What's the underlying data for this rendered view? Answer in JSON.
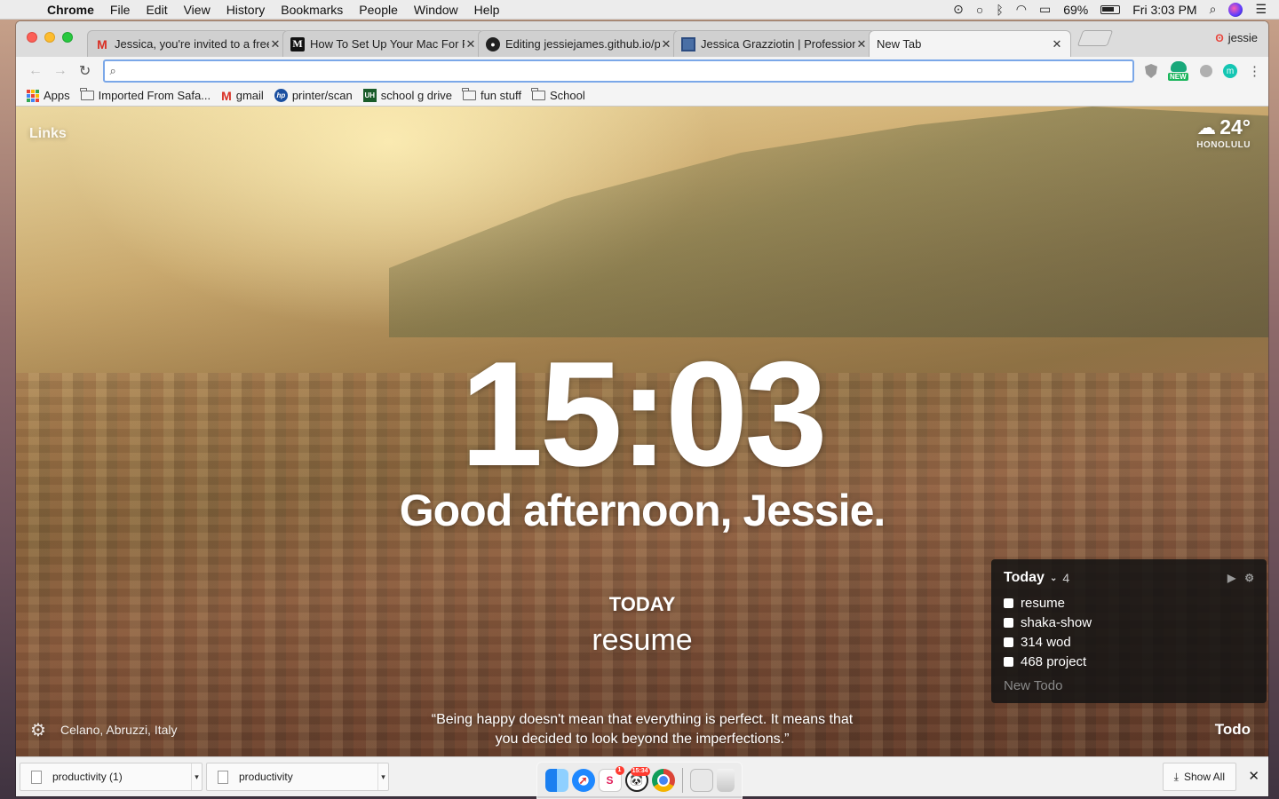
{
  "menubar": {
    "app_name": "Chrome",
    "items": [
      "File",
      "Edit",
      "View",
      "History",
      "Bookmarks",
      "People",
      "Window",
      "Help"
    ],
    "battery": "69%",
    "datetime": "Fri 3:03 PM"
  },
  "tabs": [
    {
      "title": "Jessica, you're invited to a free",
      "icon": "gmail-icon"
    },
    {
      "title": "How To Set Up Your Mac For F",
      "icon": "medium-icon"
    },
    {
      "title": "Editing jessiejames.github.io/p",
      "icon": "github-icon"
    },
    {
      "title": "Jessica Grazziotin | Profession",
      "icon": "doc-icon"
    },
    {
      "title": "New Tab",
      "icon": ""
    }
  ],
  "profile_name": "jessie",
  "omnibox": {
    "value": "",
    "placeholder": ""
  },
  "extensions": {
    "new_badge": "NEW",
    "m_label": "m"
  },
  "bookmarks": [
    {
      "label": "Apps",
      "icon": "apps-grid-icon"
    },
    {
      "label": "Imported From Safa...",
      "icon": "folder-icon"
    },
    {
      "label": "gmail",
      "icon": "gmail-icon"
    },
    {
      "label": "printer/scan",
      "icon": "hp-icon"
    },
    {
      "label": "school g drive",
      "icon": "uh-icon"
    },
    {
      "label": "fun stuff",
      "icon": "folder-icon"
    },
    {
      "label": "School",
      "icon": "folder-icon"
    }
  ],
  "momentum": {
    "links_label": "Links",
    "weather": {
      "temp": "24°",
      "city": "HONOLULU",
      "icon": "cloud-rain-icon"
    },
    "clock": "15:03",
    "greeting": "Good afternoon, Jessie.",
    "focus_label": "TODAY",
    "focus_task": "resume",
    "quote": "“Being happy doesn't mean that everything is perfect. It means that you decided to look beyond the imperfections.”",
    "location": "Celano, Abruzzi, Italy",
    "todo_toggle": "Todo",
    "todo": {
      "list_name": "Today",
      "count": "4",
      "items": [
        "resume",
        "shaka-show",
        "314 wod",
        "468 project"
      ],
      "new_placeholder": "New Todo"
    }
  },
  "downloads": {
    "items": [
      "productivity (1)",
      "productivity"
    ],
    "show_all": "Show All"
  },
  "dock": {
    "calendar_badge": "1",
    "panda_badge": "15:34"
  }
}
